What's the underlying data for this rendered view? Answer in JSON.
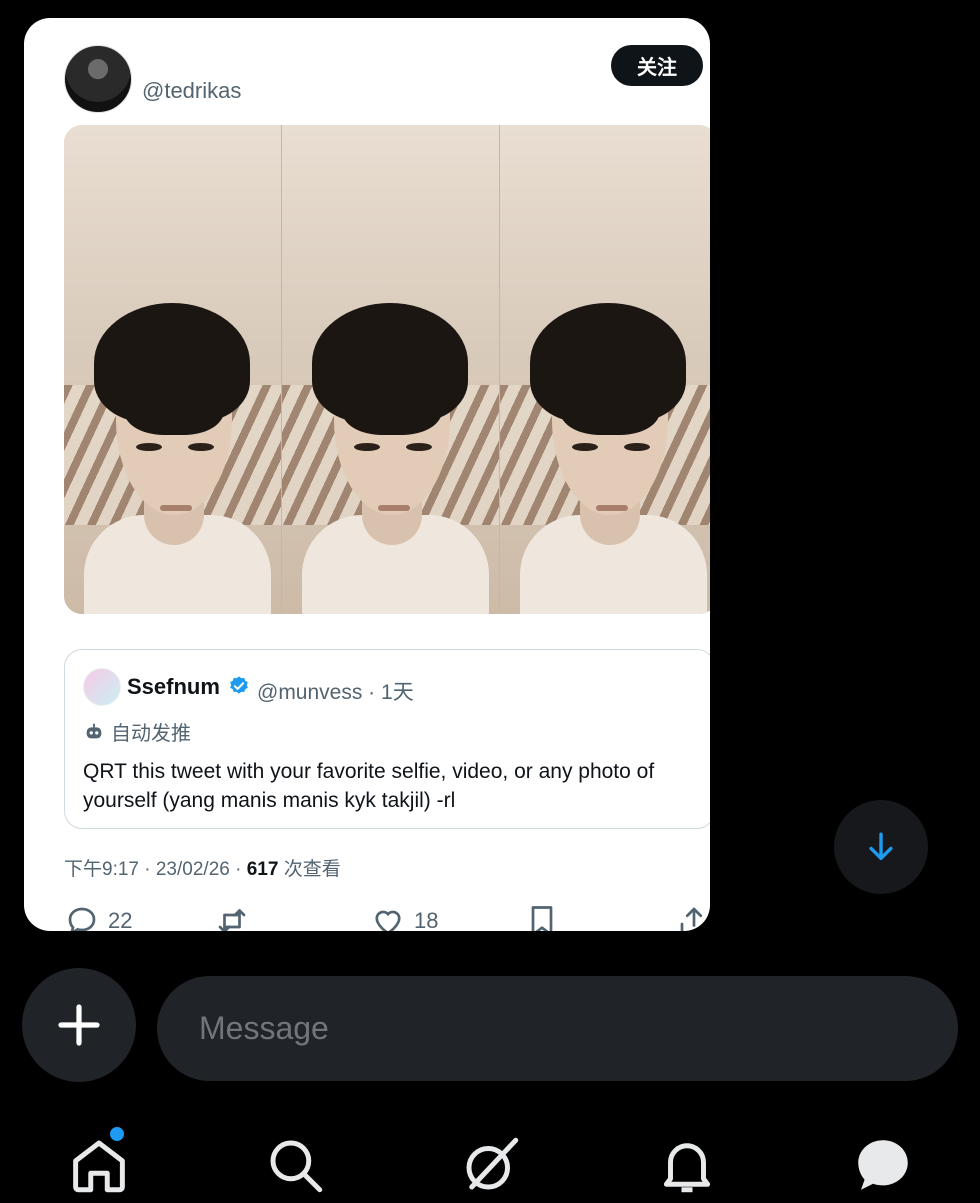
{
  "tweet": {
    "handle": "@tedrikas",
    "follow_label": "关注",
    "timestamp": "下午9:17 · 23/02/26 · ",
    "views_count": "617",
    "views_label": " 次查看",
    "actions": {
      "reply_count": "22",
      "like_count": "18"
    }
  },
  "quote": {
    "name": "Ssefnum",
    "handle_time": "@munvess · 1天",
    "auto_label": "自动发推",
    "text": "QRT this tweet with your favorite selfie, video, or any photo of yourself (yang manis manis kyk takjil) -rl"
  },
  "composer": {
    "placeholder": "Message"
  },
  "icons": {
    "accent": "#1d9bf0",
    "tabs": [
      "home-icon",
      "search-icon",
      "grok-icon",
      "bell-icon",
      "messages-icon"
    ]
  }
}
